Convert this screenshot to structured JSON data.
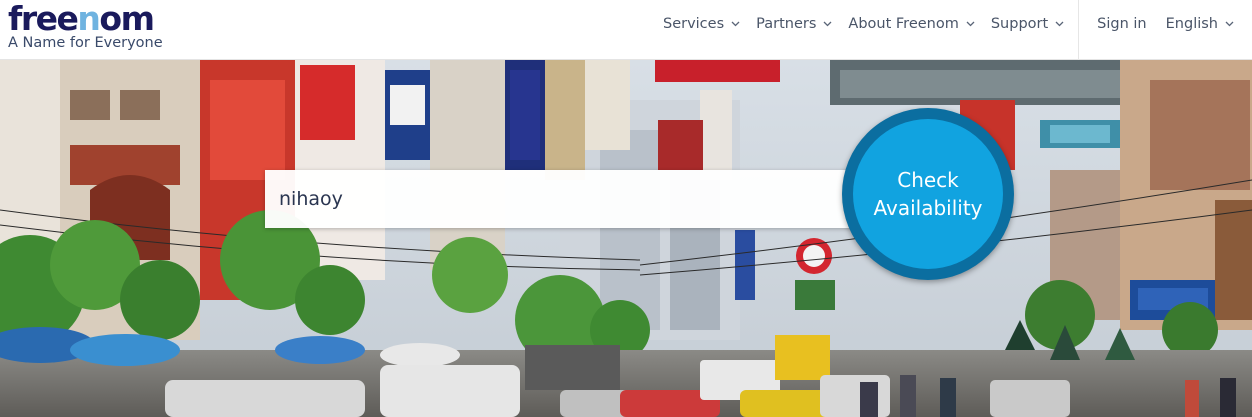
{
  "brand": {
    "logo_prefix": "free",
    "logo_accent": "n",
    "logo_suffix": "om",
    "tagline": "A Name for Everyone",
    "color_dark": "#1a1a5c",
    "color_accent": "#6fb3e0"
  },
  "nav": {
    "items": [
      {
        "label": "Services",
        "icon": "chevron-down-icon"
      },
      {
        "label": "Partners",
        "icon": "chevron-down-icon"
      },
      {
        "label": "About Freenom",
        "icon": "chevron-down-icon"
      },
      {
        "label": "Support",
        "icon": "chevron-down-icon"
      }
    ],
    "signin": "Sign in",
    "language": "English",
    "language_icon": "chevron-down-icon"
  },
  "search": {
    "value": "nihaoy",
    "placeholder": ""
  },
  "check_button": {
    "line1": "Check",
    "line2": "Availability",
    "color_outer": "#0b6ea0",
    "color_inner": "#11a3e0"
  }
}
